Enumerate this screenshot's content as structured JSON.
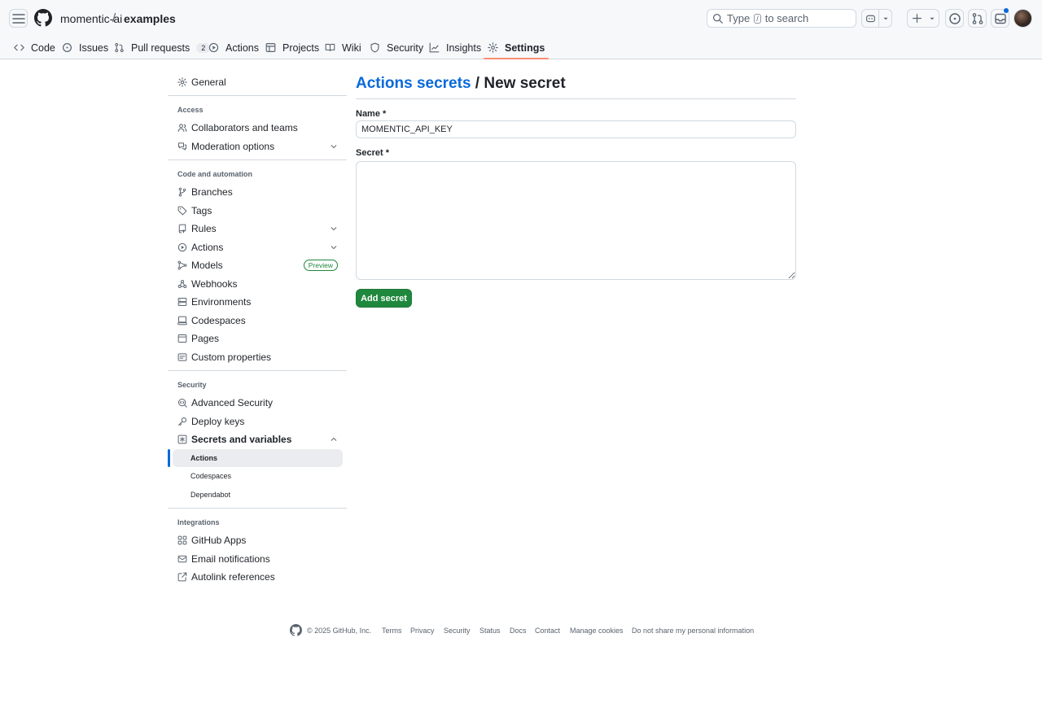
{
  "header": {
    "owner": "momentic-ai",
    "separator": "/",
    "repo": "examples",
    "search": {
      "prefix": "Type",
      "key": "/",
      "suffix": "to search"
    }
  },
  "repo_nav": {
    "tabs": [
      {
        "label": "Code",
        "icon": "code-icon"
      },
      {
        "label": "Issues",
        "icon": "issue-opened-icon"
      },
      {
        "label": "Pull requests",
        "icon": "git-pull-request-icon",
        "count": "2"
      },
      {
        "label": "Actions",
        "icon": "play-icon"
      },
      {
        "label": "Projects",
        "icon": "table-icon"
      },
      {
        "label": "Wiki",
        "icon": "book-icon"
      },
      {
        "label": "Security",
        "icon": "shield-icon"
      },
      {
        "label": "Insights",
        "icon": "graph-icon"
      },
      {
        "label": "Settings",
        "icon": "gear-icon",
        "selected": true
      }
    ]
  },
  "sidebar": {
    "general": "General",
    "access": {
      "heading": "Access",
      "items": [
        "Collaborators and teams",
        "Moderation options"
      ]
    },
    "code": {
      "heading": "Code and automation",
      "items": [
        "Branches",
        "Tags",
        "Rules",
        "Actions",
        "Models",
        "Webhooks",
        "Environments",
        "Codespaces",
        "Pages",
        "Custom properties"
      ],
      "models_badge": "Preview"
    },
    "security": {
      "heading": "Security",
      "items": [
        "Advanced Security",
        "Deploy keys",
        "Secrets and variables"
      ],
      "sub_items": [
        "Actions",
        "Codespaces",
        "Dependabot"
      ]
    },
    "integrations": {
      "heading": "Integrations",
      "items": [
        "GitHub Apps",
        "Email notifications",
        "Autolink references"
      ]
    }
  },
  "main": {
    "title_link": "Actions secrets",
    "title_sep": "/",
    "title_rest": "New secret",
    "name_label": "Name *",
    "name_value": "MOMENTIC_API_KEY",
    "secret_label": "Secret *",
    "secret_value": "",
    "submit_label": "Add secret"
  },
  "footer": {
    "copyright": "© 2025 GitHub, Inc.",
    "links": [
      "Terms",
      "Privacy",
      "Security",
      "Status",
      "Docs",
      "Contact",
      "Manage cookies",
      "Do not share my personal information"
    ]
  },
  "colors": {
    "accent": "#0969da",
    "primary_button": "#1f883d",
    "selected_tab_underline": "#fd8c73",
    "header_bg": "#f6f8fa",
    "border": "#d1d9e0"
  }
}
